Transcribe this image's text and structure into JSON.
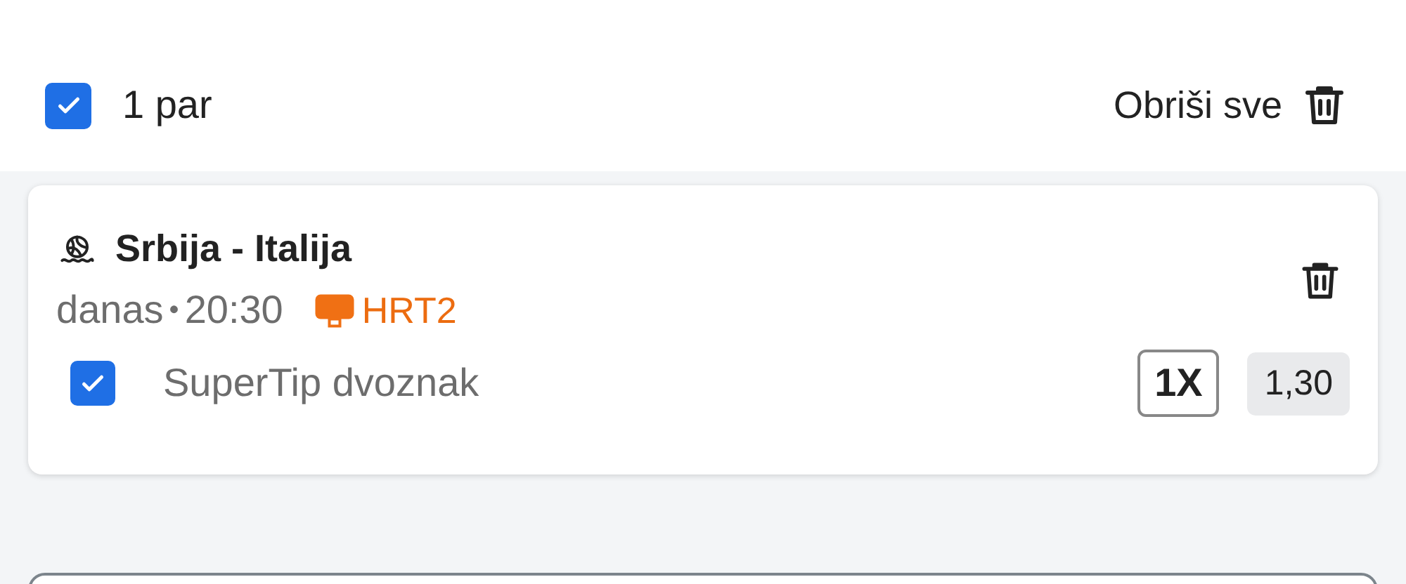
{
  "header": {
    "checked": true,
    "count": "1 par",
    "clear_label": "Obriši sve"
  },
  "pairs": [
    {
      "title": "Srbija - Italija",
      "day": "danas",
      "separator": "•",
      "time": "20:30",
      "channel": "HRT2",
      "pick": {
        "checked": true,
        "market": "SuperTip dvoznak",
        "tip": "1X",
        "odds": "1,30"
      }
    }
  ]
}
